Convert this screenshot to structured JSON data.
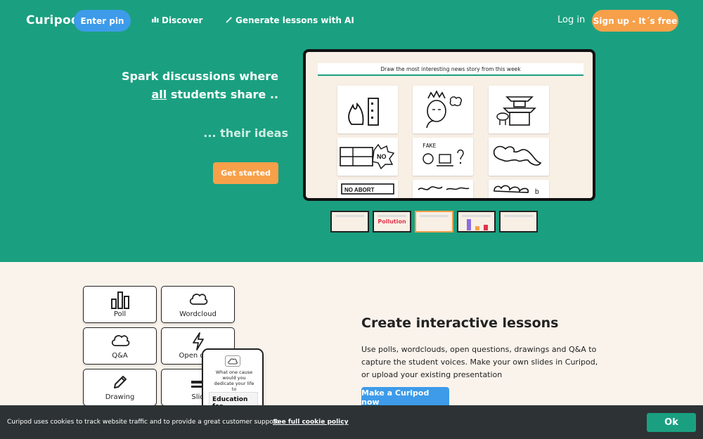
{
  "header": {
    "logo": "Curipod",
    "enter_pin": "Enter pin",
    "discover": "Discover",
    "generate": "Generate lessons with AI",
    "login": "Log in",
    "signup": "Sign up - It´s free"
  },
  "hero": {
    "line1": "Spark discussions where",
    "line2_underlined": "all",
    "line2_rest": " students share ..",
    "line3": "... their ideas",
    "cta": "Get started",
    "slide_prompt": "Draw the most interesting news story from this week",
    "card_texts": [
      "NO",
      "FAKE",
      "NO ABORT"
    ],
    "thumb_word": "Pollution"
  },
  "features": {
    "tiles": [
      {
        "label": "Poll",
        "icon": "bar-chart-icon"
      },
      {
        "label": "Wordcloud",
        "icon": "cloud-icon"
      },
      {
        "label": "Q&A",
        "icon": "cloud-icon"
      },
      {
        "label": "Open ques",
        "icon": "lightning-icon"
      },
      {
        "label": "Drawing",
        "icon": "pencil-icon"
      },
      {
        "label": "Slid",
        "icon": "slides-icon"
      }
    ],
    "phone_question": "What one cause would you dedicate your life to",
    "phone_answer": "Education for",
    "title": "Create interactive lessons",
    "description": "Use polls, wordclouds, open questions, drawings and Q&A to capture the student voices. Make your own slides in Curipod, or upload your existing presentation",
    "cta": "Make a Curipod now"
  },
  "cookie": {
    "text": "Curipod uses cookies to track website traffic and to provide a great customer support.",
    "link": "See full cookie policy",
    "ok": "Ok"
  },
  "colors": {
    "brand_green": "#1aa080",
    "orange": "#f7a04a",
    "blue": "#3d9be9",
    "cream": "#faf3ec",
    "dark_bar": "#2d3334"
  }
}
